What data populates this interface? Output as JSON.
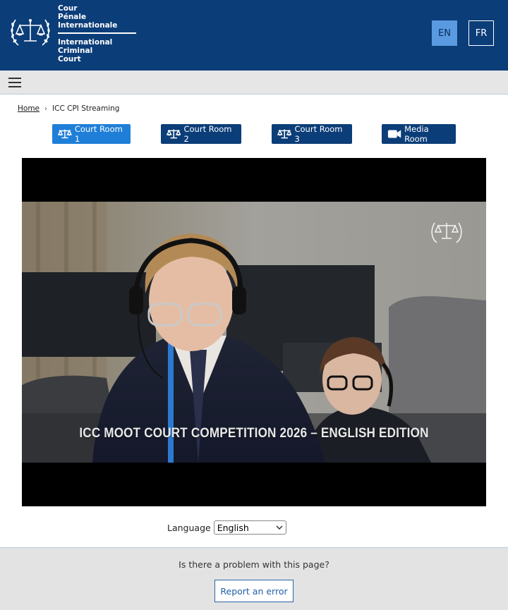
{
  "header": {
    "logo_lines_fr": [
      "Cour",
      "Pénale",
      "Internationale"
    ],
    "logo_lines_en": [
      "International",
      "Criminal",
      "Court"
    ],
    "lang_en": "EN",
    "lang_fr": "FR",
    "bg_color": "#0b3d78"
  },
  "menu": {
    "icon": "hamburger-icon"
  },
  "breadcrumb": {
    "home": "Home",
    "separator": "›",
    "current": "ICC CPI Streaming"
  },
  "rooms": [
    {
      "label": "Court Room 1",
      "icon": "scales-icon",
      "active": true
    },
    {
      "label": "Court Room 2",
      "icon": "scales-icon",
      "active": false
    },
    {
      "label": "Court Room 3",
      "icon": "scales-icon",
      "active": false
    },
    {
      "label": "Media Room",
      "icon": "video-camera-icon",
      "active": false
    }
  ],
  "video": {
    "caption": "ICC MOOT COURT COMPETITION 2026 – ENGLISH EDITION"
  },
  "language": {
    "label": "Language",
    "selected": "English"
  },
  "footer": {
    "question": "Is there a problem with this page?",
    "report_label": "Report an error"
  },
  "colors": {
    "primary": "#0b3d78",
    "active_button": "#1f7fd8",
    "link": "#1f5fa8"
  }
}
